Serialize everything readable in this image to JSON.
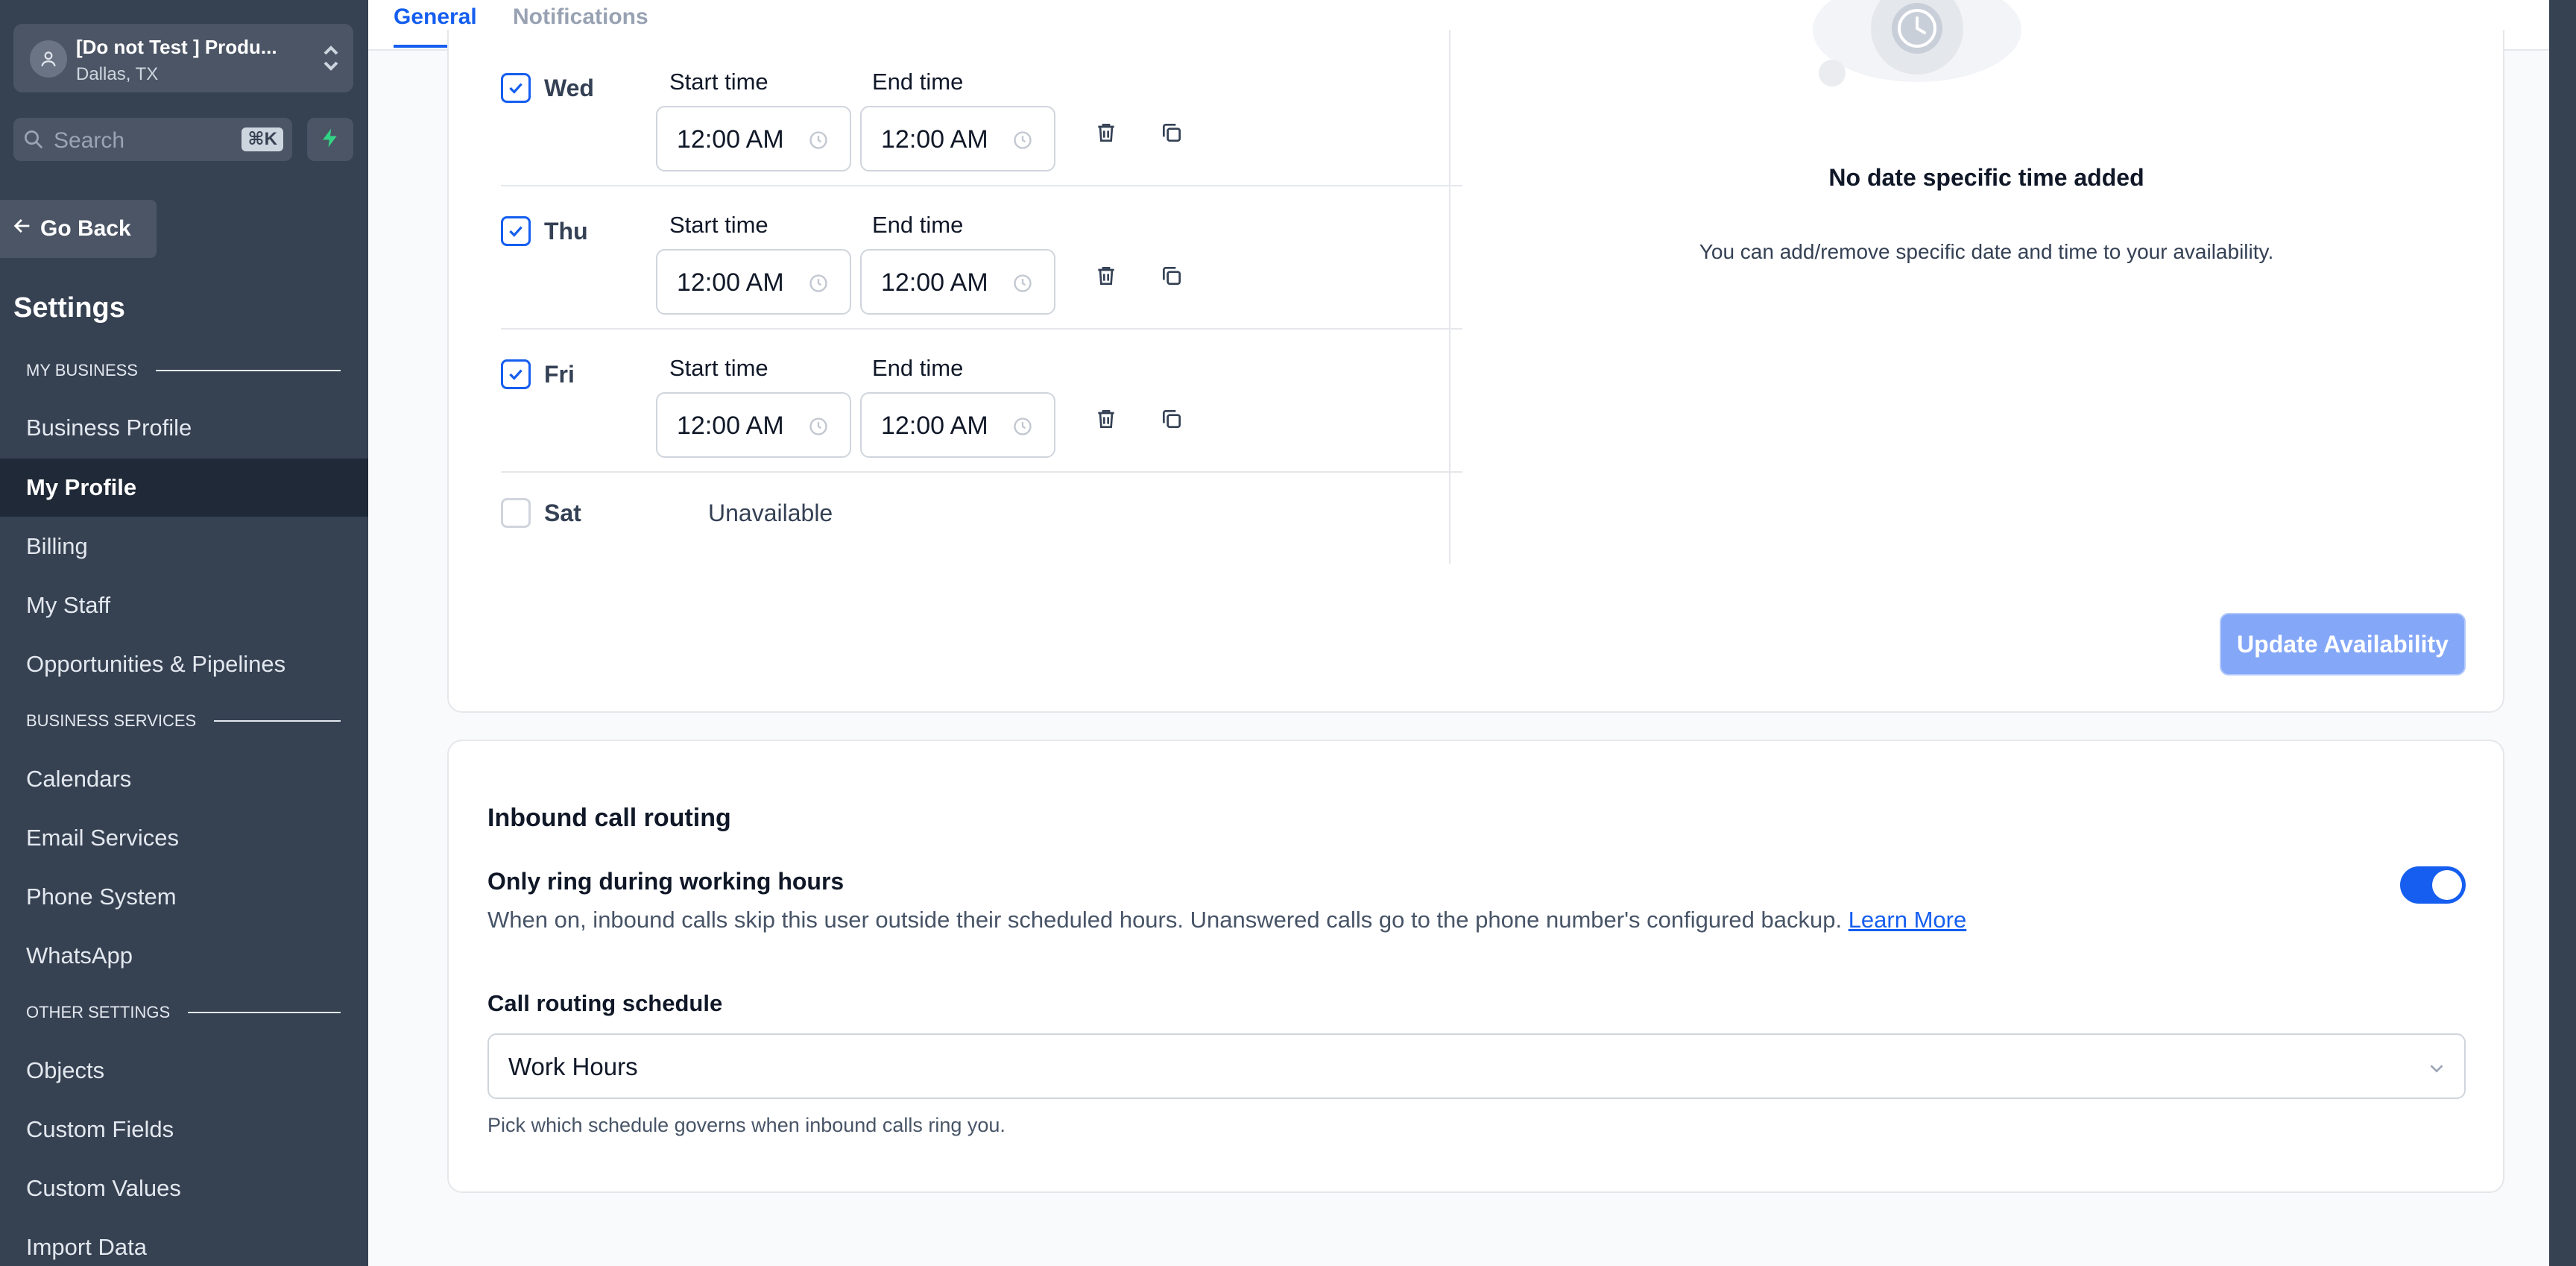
{
  "location": {
    "name": "[Do not Test ] Produ...",
    "city": "Dallas, TX"
  },
  "search": {
    "placeholder": "Search",
    "shortcut": "⌘K"
  },
  "sidebar": {
    "go_back": "Go Back",
    "title": "Settings",
    "sections": {
      "my_business": "MY BUSINESS",
      "business_services": "BUSINESS SERVICES",
      "other_settings": "OTHER SETTINGS"
    },
    "items": [
      {
        "label": "Business Profile",
        "active": false
      },
      {
        "label": "My Profile",
        "active": true
      },
      {
        "label": "Billing",
        "active": false
      },
      {
        "label": "My Staff",
        "active": false
      },
      {
        "label": "Opportunities & Pipelines",
        "active": false
      },
      {
        "label": "Calendars",
        "active": false
      },
      {
        "label": "Email Services",
        "active": false
      },
      {
        "label": "Phone System",
        "active": false
      },
      {
        "label": "WhatsApp",
        "active": false
      },
      {
        "label": "Objects",
        "active": false
      },
      {
        "label": "Custom Fields",
        "active": false
      },
      {
        "label": "Custom Values",
        "active": false
      },
      {
        "label": "Import Data",
        "active": false
      }
    ]
  },
  "tabs": {
    "general": "General",
    "notifications": "Notifications"
  },
  "availability": {
    "start_label": "Start time",
    "end_label": "End time",
    "unavailable_label": "Unavailable",
    "days": [
      {
        "name": "Wed",
        "checked": true,
        "start": "12:00 AM",
        "end": "12:00 AM"
      },
      {
        "name": "Thu",
        "checked": true,
        "start": "12:00 AM",
        "end": "12:00 AM"
      },
      {
        "name": "Fri",
        "checked": true,
        "start": "12:00 AM",
        "end": "12:00 AM"
      },
      {
        "name": "Sat",
        "checked": false
      }
    ],
    "empty_title": "No date specific time added",
    "empty_subtitle": "You can add/remove specific date and time to your availability.",
    "update_button": "Update Availability"
  },
  "call_routing": {
    "title": "Inbound call routing",
    "ring_label": "Only ring during working hours",
    "ring_description": "When on, inbound calls skip this user outside their scheduled hours. Unanswered calls go to the phone number's configured backup.",
    "learn_more": "Learn More",
    "toggle_on": true,
    "schedule_label": "Call routing schedule",
    "schedule_value": "Work Hours",
    "schedule_help": "Pick which schedule governs when inbound calls ring you."
  },
  "colors": {
    "accent": "#155eef",
    "sidebar_bg": "#364152",
    "active_nav": "#1f2937"
  }
}
